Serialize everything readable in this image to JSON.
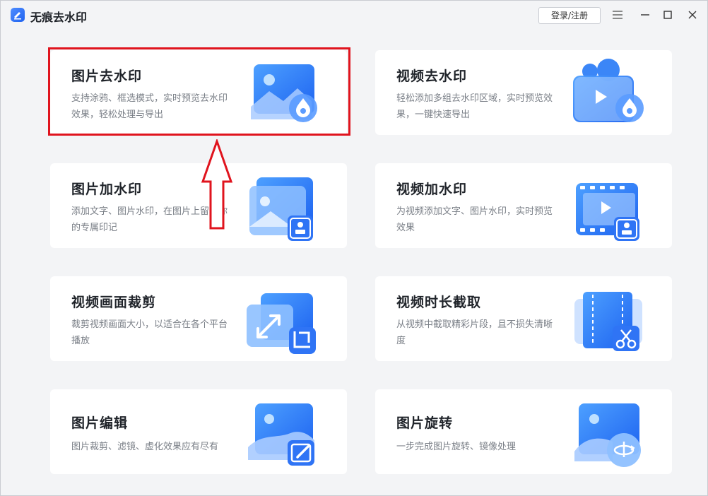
{
  "app": {
    "title": "无痕去水印",
    "login_label": "登录/注册"
  },
  "cards": [
    {
      "title": "图片去水印",
      "desc": "支持涂鸦、框选模式，实时预览去水印效果，轻松处理与导出"
    },
    {
      "title": "视频去水印",
      "desc": "轻松添加多组去水印区域，实时预览效果，一键快速导出"
    },
    {
      "title": "图片加水印",
      "desc": "添加文字、图片水印，在图片上留下你的专属印记"
    },
    {
      "title": "视频加水印",
      "desc": "为视频添加文字、图片水印，实时预览效果"
    },
    {
      "title": "视频画面裁剪",
      "desc": "裁剪视频画面大小，以适合在各个平台播放"
    },
    {
      "title": "视频时长截取",
      "desc": "从视频中截取精彩片段，且不损失清晰度"
    },
    {
      "title": "图片编辑",
      "desc": "图片裁剪、滤镜、虚化效果应有尽有"
    },
    {
      "title": "图片旋转",
      "desc": "一步完成图片旋转、镜像处理"
    }
  ],
  "colors": {
    "accent": "#2f74f5",
    "highlight": "#e0141e"
  },
  "icons": [
    "app-logo-icon",
    "menu-icon",
    "minimize-icon",
    "maximize-icon",
    "close-icon"
  ]
}
